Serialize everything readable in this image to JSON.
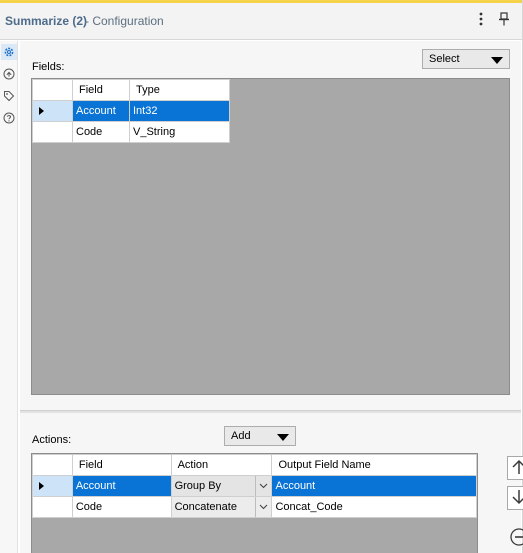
{
  "header": {
    "title": "Summarize (2)",
    "subtitle": "- Configuration",
    "more_icon": "vertical-ellipsis-icon",
    "pin_icon": "pin-icon"
  },
  "rail": {
    "icons": [
      "gear-icon",
      "circle-arrow-icon",
      "tag-icon",
      "help-icon"
    ],
    "accent": "#1f73c8"
  },
  "fields": {
    "label": "Fields:",
    "select_button": "Select",
    "columns": [
      "Field",
      "Type"
    ],
    "rows": [
      {
        "field": "Account",
        "type": "Int32",
        "selected": true
      },
      {
        "field": "Code",
        "type": "V_String",
        "selected": false
      }
    ]
  },
  "actions": {
    "label": "Actions:",
    "add_button": "Add",
    "columns": [
      "Field",
      "Action",
      "Output Field Name"
    ],
    "rows": [
      {
        "field": "Account",
        "action": "Group By",
        "output": "Account",
        "selected": true
      },
      {
        "field": "Code",
        "action": "Concatenate",
        "output": "Concat_Code",
        "selected": false
      }
    ],
    "side_buttons": [
      "arrow-up-icon",
      "arrow-down-icon",
      "remove-icon"
    ]
  },
  "colors": {
    "selection": "#0a74d6",
    "header_border": "#f6d24a",
    "grid_background": "#a8a8a8"
  }
}
